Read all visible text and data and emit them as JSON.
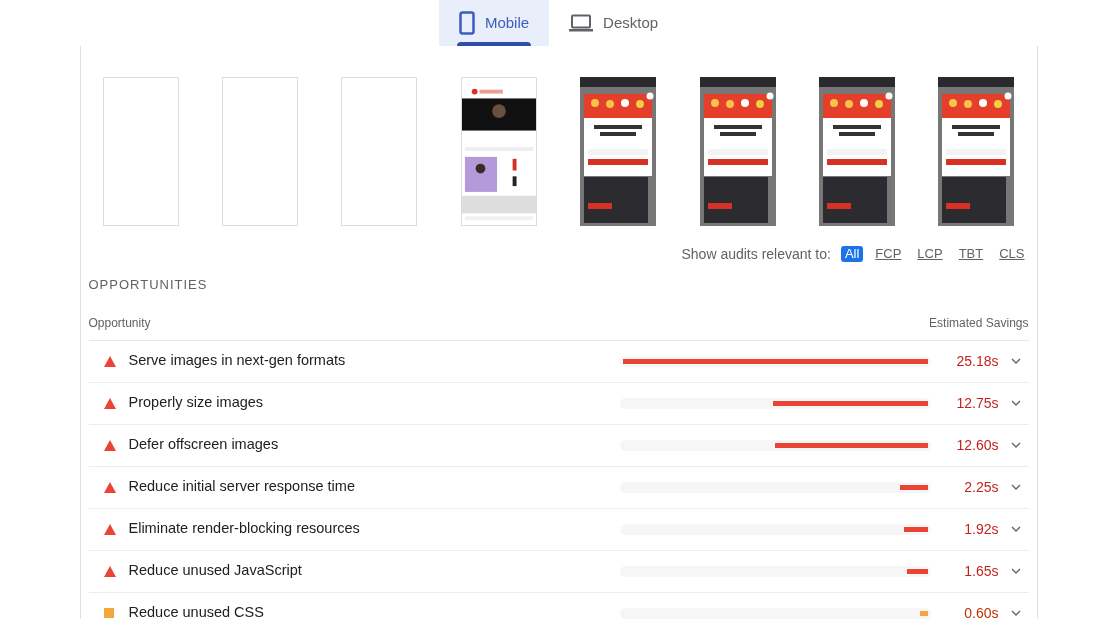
{
  "device_tabs": [
    {
      "label": "Mobile",
      "selected": true
    },
    {
      "label": "Desktop",
      "selected": false
    }
  ],
  "filmstrip": [
    {
      "kind": "blank"
    },
    {
      "kind": "blank"
    },
    {
      "kind": "blank"
    },
    {
      "kind": "page"
    },
    {
      "kind": "popup"
    },
    {
      "kind": "popup"
    },
    {
      "kind": "popup"
    },
    {
      "kind": "popup"
    }
  ],
  "metric_filter": {
    "label": "Show audits relevant to:",
    "options": [
      {
        "label": "All",
        "selected": true
      },
      {
        "label": "FCP",
        "selected": false
      },
      {
        "label": "LCP",
        "selected": false
      },
      {
        "label": "TBT",
        "selected": false
      },
      {
        "label": "CLS",
        "selected": false
      }
    ]
  },
  "opportunities": {
    "title": "OPPORTUNITIES",
    "columns": [
      "Opportunity",
      "Estimated Savings"
    ],
    "rows": [
      {
        "kind": "fail",
        "title": "Serve images in next-gen formats",
        "level": 1,
        "savings": "25.18s"
      },
      {
        "kind": "fail",
        "title": "Properly size images",
        "level": 0.505,
        "savings": "12.75s"
      },
      {
        "kind": "fail",
        "title": "Defer offscreen images",
        "level": 0.5,
        "savings": "12.60s"
      },
      {
        "kind": "fail",
        "title": "Reduce initial server response time",
        "level": 0.089,
        "savings": "2.25s"
      },
      {
        "kind": "fail",
        "title": "Eliminate render-blocking resources",
        "level": 0.076,
        "savings": "1.92s"
      },
      {
        "kind": "fail",
        "title": "Reduce unused JavaScript",
        "level": 0.066,
        "savings": "1.65s"
      },
      {
        "kind": "average",
        "title": "Reduce unused CSS",
        "level": 0.026,
        "savings": "0.60s"
      }
    ]
  }
}
